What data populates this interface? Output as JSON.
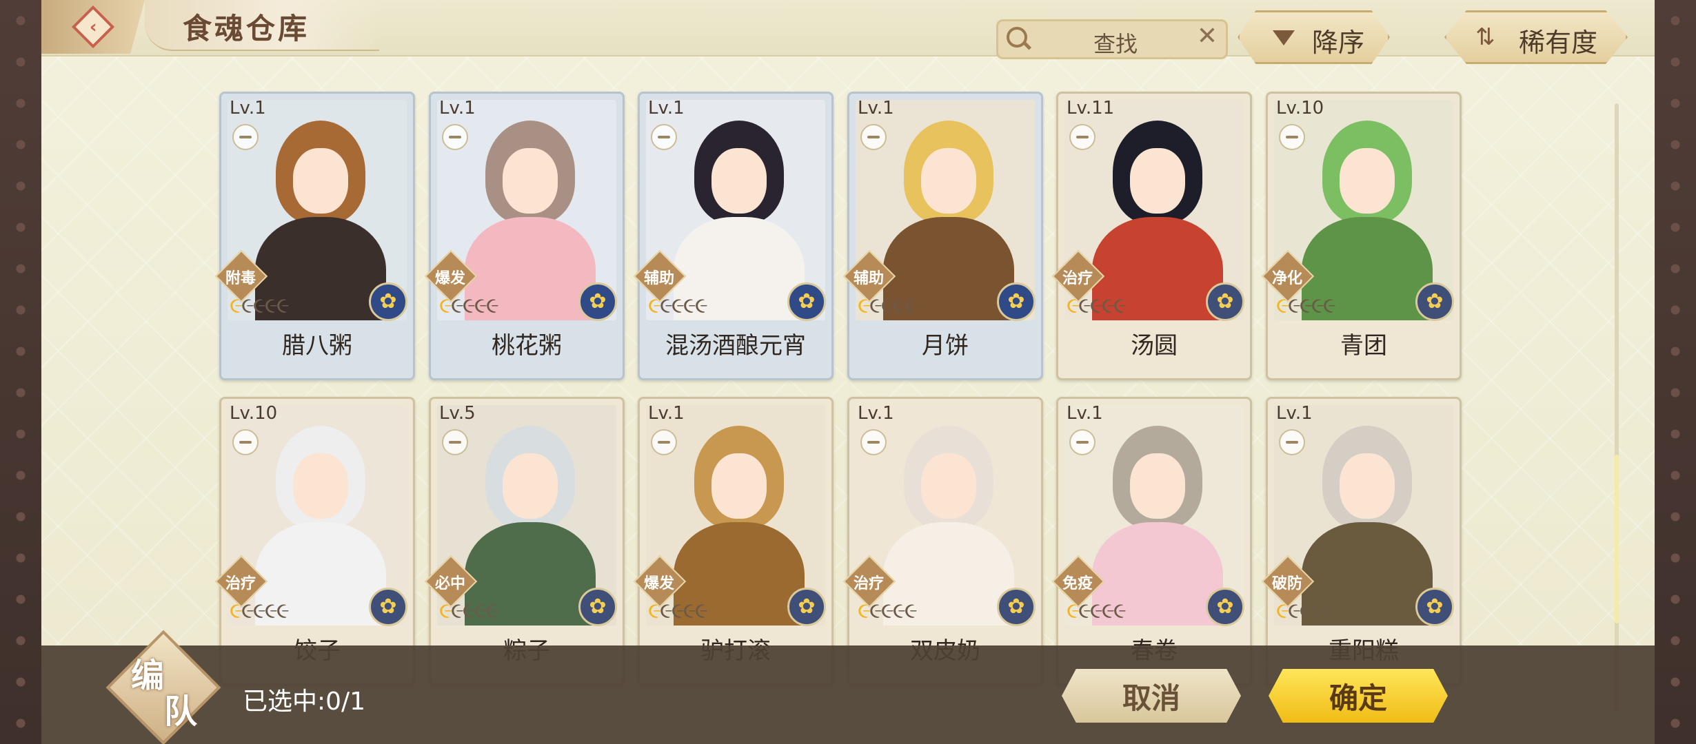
{
  "header": {
    "title": "食魂仓库",
    "search_placeholder": "查找",
    "clear_icon": "✕",
    "sort_order_label": "降序",
    "sort_rarity_label": "稀有度"
  },
  "cards": [
    {
      "level": "Lv.1",
      "role": "附毒",
      "name": "腊八粥",
      "stars_on": 1,
      "stars_total": 5,
      "style": "blue",
      "hair": "#a86a34",
      "outfit": "#3a2f2a",
      "bg": "#dfe6ea",
      "element": "#2f4a86"
    },
    {
      "level": "Lv.1",
      "role": "爆发",
      "name": "桃花粥",
      "stars_on": 1,
      "stars_total": 5,
      "style": "blue",
      "hair": "#a89084",
      "outfit": "#f4b8c0",
      "bg": "#e4e8ef",
      "element": "#2f4a86"
    },
    {
      "level": "Lv.1",
      "role": "辅助",
      "name": "混汤酒酿元宵",
      "stars_on": 1,
      "stars_total": 5,
      "style": "blue",
      "hair": "#2a2430",
      "outfit": "#f5f1ec",
      "bg": "#e6e9ee",
      "element": "#2f4a86"
    },
    {
      "level": "Lv.1",
      "role": "辅助",
      "name": "月饼",
      "stars_on": 1,
      "stars_total": 5,
      "style": "blue",
      "hair": "#e8c25c",
      "outfit": "#7a5330",
      "bg": "#ebe4d4",
      "element": "#2f4a86"
    },
    {
      "level": "Lv.11",
      "role": "治疗",
      "name": "汤圆",
      "stars_on": 1,
      "stars_total": 5,
      "style": "tan",
      "hair": "#1e1e2a",
      "outfit": "#c8432f",
      "bg": "#ece5d6",
      "element": "#3f4f78"
    },
    {
      "level": "Lv.10",
      "role": "净化",
      "name": "青团",
      "stars_on": 1,
      "stars_total": 5,
      "style": "tan",
      "hair": "#7cbf62",
      "outfit": "#5e9448",
      "bg": "#e8e6d2",
      "element": "#3f4f78"
    },
    {
      "level": "Lv.10",
      "role": "治疗",
      "name": "饺子",
      "stars_on": 1,
      "stars_total": 5,
      "style": "tan",
      "hair": "#eeeeee",
      "outfit": "#f2f2f2",
      "bg": "#ece5d8",
      "element": "#3f4f78"
    },
    {
      "level": "Lv.5",
      "role": "必中",
      "name": "粽子",
      "stars_on": 1,
      "stars_total": 5,
      "style": "tan",
      "hair": "#d8dde0",
      "outfit": "#4f6d4a",
      "bg": "#e6e1d2",
      "element": "#3f4f78"
    },
    {
      "level": "Lv.1",
      "role": "爆发",
      "name": "驴打滚",
      "stars_on": 1,
      "stars_total": 5,
      "style": "tan",
      "hair": "#c89850",
      "outfit": "#9a6a30",
      "bg": "#ece2d0",
      "element": "#3f4f78"
    },
    {
      "level": "Lv.1",
      "role": "治疗",
      "name": "双皮奶",
      "stars_on": 1,
      "stars_total": 5,
      "style": "tan",
      "hair": "#e8e0d6",
      "outfit": "#f5efe6",
      "bg": "#efe6d6",
      "element": "#3f4f78"
    },
    {
      "level": "Lv.1",
      "role": "免疫",
      "name": "春卷",
      "stars_on": 1,
      "stars_total": 5,
      "style": "tan",
      "hair": "#b4aa9c",
      "outfit": "#f4c8d2",
      "bg": "#eee8d8",
      "element": "#3f4f78"
    },
    {
      "level": "Lv.1",
      "role": "破防",
      "name": "重阳糕",
      "stars_on": 1,
      "stars_total": 5,
      "style": "tan",
      "hair": "#d4cec4",
      "outfit": "#6a5a3e",
      "bg": "#ebe3d2",
      "element": "#3f4f78"
    }
  ],
  "footer": {
    "team_char1": "编",
    "team_char2": "队",
    "selected_text": "已选中:0/1",
    "cancel_label": "取消",
    "confirm_label": "确定"
  }
}
